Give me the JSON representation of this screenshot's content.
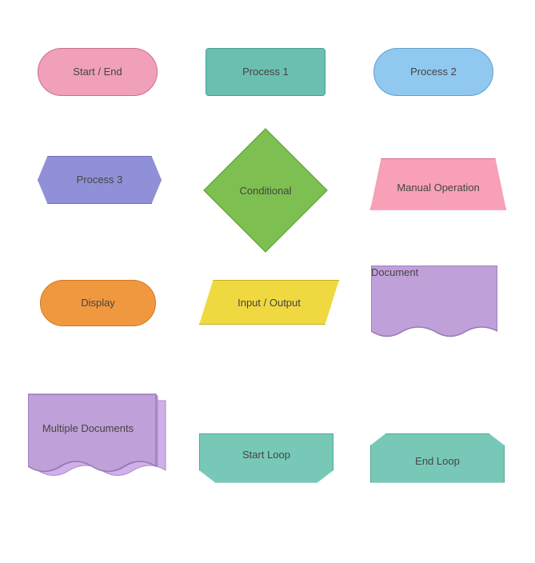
{
  "shapes": {
    "start_end": {
      "label": "Start / End"
    },
    "process1": {
      "label": "Process 1"
    },
    "process2": {
      "label": "Process 2"
    },
    "process3": {
      "label": "Process 3"
    },
    "conditional": {
      "label": "Conditional"
    },
    "manual_operation": {
      "label": "Manual Operation"
    },
    "display": {
      "label": "Display"
    },
    "input_output": {
      "label": "Input / Output"
    },
    "document": {
      "label": "Document"
    },
    "multiple_documents": {
      "label": "Multiple Documents"
    },
    "start_loop": {
      "label": "Start Loop"
    },
    "end_loop": {
      "label": "End Loop"
    }
  }
}
